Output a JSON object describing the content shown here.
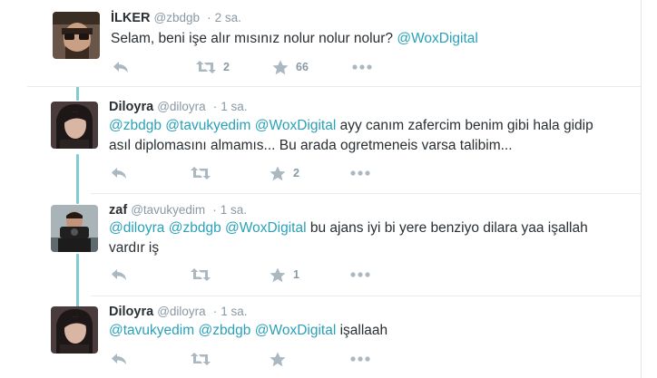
{
  "tweets": [
    {
      "name": "İLKER",
      "handle": "@zbdgb",
      "separator": "·",
      "time": "2 sa.",
      "text_plain": "Selam, beni işe alır mısınız nolur nolur nolur? ",
      "mentions": [
        "@WoxDigital"
      ],
      "line2": "",
      "retweets": "2",
      "favorites": "66"
    },
    {
      "name": "Diloyra",
      "handle": "@diloyra",
      "separator": "·",
      "time": "1 sa.",
      "mentions": [
        "@zbdgb",
        "@tavukyedim",
        "@WoxDigital"
      ],
      "text_plain": " ayy canım zafercim benim gibi hala gidip",
      "line2": "asıl diplomasını almamıs... Bu arada ogretmeneis varsa talibim...",
      "retweets": "",
      "favorites": "2"
    },
    {
      "name": "zaf",
      "handle": "@tavukyedim",
      "separator": "·",
      "time": "1 sa.",
      "mentions": [
        "@diloyra",
        "@zbdgb",
        "@WoxDigital"
      ],
      "text_plain": " bu ajans iyi bi yere benziyo dilara yaa işallah",
      "line2": "vardır iş",
      "retweets": "",
      "favorites": "1"
    },
    {
      "name": "Diloyra",
      "handle": "@diloyra",
      "separator": "·",
      "time": "1 sa.",
      "mentions": [
        "@tavukyedim",
        "@zbdgb",
        "@WoxDigital"
      ],
      "text_plain": " işallaah",
      "line2": "",
      "retweets": "",
      "favorites": ""
    }
  ],
  "icons": [
    "reply-icon",
    "retweet-icon",
    "favorite-icon",
    "more-icon"
  ],
  "colors": {
    "link": "#2aa1b8",
    "thread_line": "#7fcdd2",
    "icon": "#aab8c2",
    "muted": "#8899a6"
  }
}
